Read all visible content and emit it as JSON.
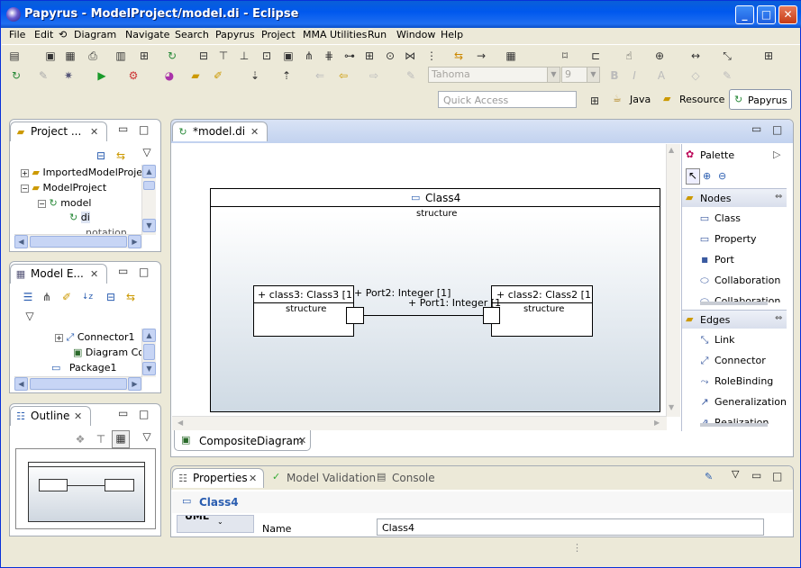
{
  "window": {
    "title": "Papyrus - ModelProject/model.di - Eclipse"
  },
  "menubar": [
    "File",
    "Edit",
    "Diagram",
    "Navigate",
    "Search",
    "Papyrus",
    "Project",
    "MMA Utilities",
    "Run",
    "Window",
    "Help"
  ],
  "toolbar": {
    "font_name": "Tahoma",
    "font_size": "9",
    "quick_access_placeholder": "Quick Access",
    "perspectives": [
      "Java",
      "Resource",
      "Papyrus"
    ]
  },
  "project_explorer": {
    "title": "Project ...",
    "items": [
      "ImportedModelProje",
      "ModelProject",
      "model",
      "di",
      "notation"
    ]
  },
  "model_explorer": {
    "title": "Model E...",
    "items": [
      "Connector1",
      "Diagram Co",
      "Package1"
    ]
  },
  "outline": {
    "title": "Outline"
  },
  "editor": {
    "tab": "*model.di",
    "diagram_tab": "CompositeDiagram",
    "class4": {
      "name": "Class4",
      "compartment": "structure"
    },
    "class3": {
      "name": "+ class3: Class3 [1",
      "compartment": "structure"
    },
    "class2": {
      "name": "+ class2: Class2 [1",
      "compartment": "structure"
    },
    "port2": "+ Port2: Integer [1]",
    "port1": "+ Port1: Integer [1"
  },
  "palette": {
    "title": "Palette",
    "nodes_header": "Nodes",
    "nodes": [
      "Class",
      "Property",
      "Port",
      "Collaboration",
      "Collaboration..."
    ],
    "edges_header": "Edges",
    "edges": [
      "Link",
      "Connector",
      "RoleBinding",
      "Generalization",
      "Realization"
    ]
  },
  "bottom": {
    "tabs": [
      "Properties",
      "Model Validation",
      "Console"
    ],
    "selected_title": "Class4",
    "side_tab": "UML",
    "name_label": "Name",
    "name_value": "Class4"
  },
  "colors": {
    "accent": "#0a246a",
    "title_blue": "#0058ee",
    "link_blue": "#2a5db0"
  }
}
